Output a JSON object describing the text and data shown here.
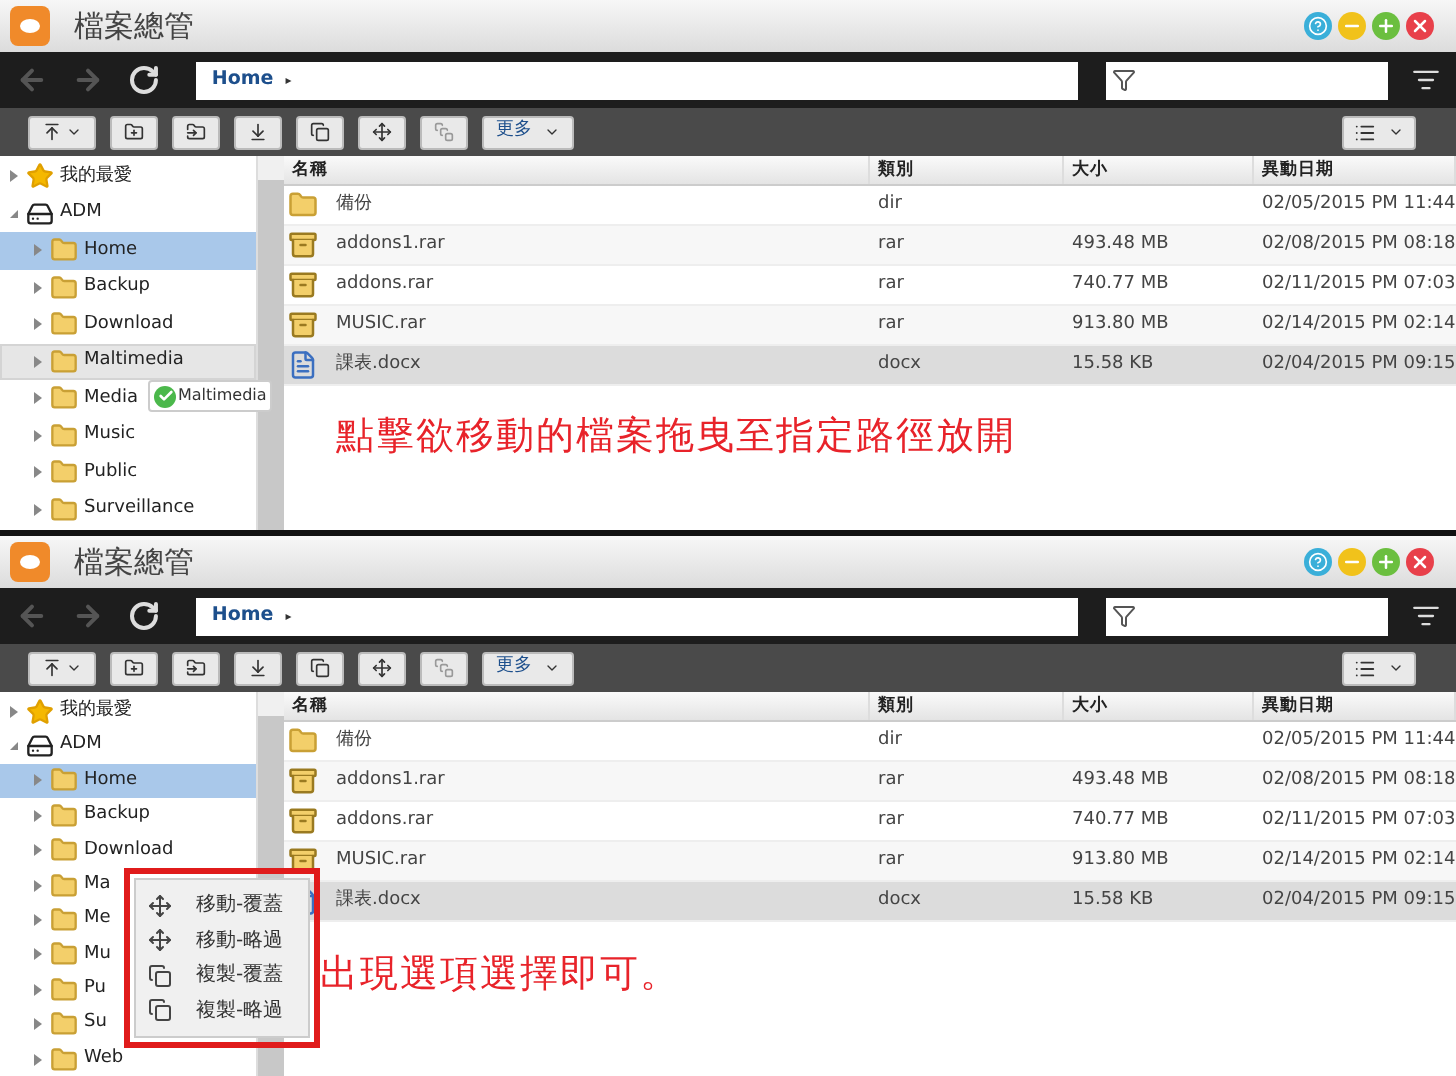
{
  "panels": [
    {
      "window": {
        "title": "檔案總管"
      },
      "path": {
        "segment": "Home",
        "separator": "▸"
      },
      "toolbar": {
        "more_button": "更多"
      },
      "sidebar": {
        "items": [
          {
            "label": "我的最愛",
            "kind": "favorites",
            "expanded": false,
            "selected": false,
            "hovered": false
          },
          {
            "label": "ADM",
            "kind": "device",
            "expanded": true,
            "selected": false,
            "hovered": false,
            "children": [
              {
                "label": "Home",
                "kind": "share",
                "expanded": false,
                "selected": true,
                "hovered": false
              },
              {
                "label": "Backup",
                "kind": "share",
                "expanded": false,
                "selected": false,
                "hovered": false
              },
              {
                "label": "Download",
                "kind": "share",
                "expanded": false,
                "selected": false,
                "hovered": false
              },
              {
                "label": "Maltimedia",
                "kind": "share",
                "expanded": false,
                "selected": false,
                "hovered": true
              },
              {
                "label": "Media",
                "kind": "share",
                "expanded": false,
                "selected": false,
                "hovered": false
              },
              {
                "label": "Music",
                "kind": "share",
                "expanded": false,
                "selected": false,
                "hovered": false
              },
              {
                "label": "Public",
                "kind": "share",
                "expanded": false,
                "selected": false,
                "hovered": false
              },
              {
                "label": "Surveillance",
                "kind": "share",
                "expanded": false,
                "selected": false,
                "hovered": false
              }
            ]
          }
        ]
      },
      "table": {
        "columns": [
          "名稱",
          "類別",
          "大小",
          "異動日期"
        ],
        "rows": [
          {
            "name": "備份",
            "type": "dir",
            "modified": "02/05/2015 PM 11:44",
            "kind": "folder",
            "selected": false
          },
          {
            "name": "addons1.rar",
            "type": "rar",
            "size": "493.48 MB",
            "modified": "02/08/2015 PM 08:18",
            "kind": "archive",
            "selected": false
          },
          {
            "name": "addons.rar",
            "type": "rar",
            "size": "740.77 MB",
            "modified": "02/11/2015 PM 07:03",
            "kind": "archive",
            "selected": false
          },
          {
            "name": "MUSIC.rar",
            "type": "rar",
            "size": "913.80 MB",
            "modified": "02/14/2015 PM 02:14",
            "kind": "archive",
            "selected": false
          },
          {
            "name": "課表.docx",
            "type": "docx",
            "size": "15.58 KB",
            "modified": "02/04/2015 PM 09:15",
            "kind": "document",
            "selected": true
          }
        ]
      },
      "drag_tooltip": {
        "label": "Maltimedia"
      },
      "annotation": {
        "text": "點擊欲移動的檔案拖曳至指定路徑放開"
      }
    },
    {
      "window": {
        "title": "檔案總管"
      },
      "path": {
        "segment": "Home",
        "separator": "▸"
      },
      "toolbar": {
        "more_button": "更多"
      },
      "sidebar": {
        "items": [
          {
            "label": "我的最愛",
            "kind": "favorites",
            "expanded": false,
            "selected": false,
            "hovered": false
          },
          {
            "label": "ADM",
            "kind": "device",
            "expanded": true,
            "selected": false,
            "hovered": false,
            "children": [
              {
                "label": "Home",
                "kind": "share",
                "expanded": false,
                "selected": true,
                "hovered": false
              },
              {
                "label": "Backup",
                "kind": "share",
                "expanded": false,
                "selected": false,
                "hovered": false
              },
              {
                "label": "Download",
                "kind": "share",
                "expanded": false,
                "selected": false,
                "hovered": false
              },
              {
                "label": "Ma",
                "kind": "share",
                "expanded": false,
                "selected": false,
                "hovered": false
              },
              {
                "label": "Me",
                "kind": "share",
                "expanded": false,
                "selected": false,
                "hovered": false
              },
              {
                "label": "Mu",
                "kind": "share",
                "expanded": false,
                "selected": false,
                "hovered": false
              },
              {
                "label": "Pu",
                "kind": "share",
                "expanded": false,
                "selected": false,
                "hovered": false
              },
              {
                "label": "Su",
                "kind": "share",
                "expanded": false,
                "selected": false,
                "hovered": false
              },
              {
                "label": "Web",
                "kind": "share",
                "expanded": false,
                "selected": false,
                "hovered": false
              }
            ]
          }
        ]
      },
      "table": {
        "columns": [
          "名稱",
          "類別",
          "大小",
          "異動日期"
        ],
        "rows": [
          {
            "name": "備份",
            "type": "dir",
            "modified": "02/05/2015 PM 11:44",
            "kind": "folder",
            "selected": false
          },
          {
            "name": "addons1.rar",
            "type": "rar",
            "size": "493.48 MB",
            "modified": "02/08/2015 PM 08:18",
            "kind": "archive",
            "selected": false
          },
          {
            "name": "addons.rar",
            "type": "rar",
            "size": "740.77 MB",
            "modified": "02/11/2015 PM 07:03",
            "kind": "archive",
            "selected": false
          },
          {
            "name": "MUSIC.rar",
            "type": "rar",
            "size": "913.80 MB",
            "modified": "02/14/2015 PM 02:14",
            "kind": "archive",
            "selected": false
          },
          {
            "name": "課表.docx",
            "type": "docx",
            "size": "15.58 KB",
            "modified": "02/04/2015 PM 09:15",
            "kind": "document",
            "selected": true
          }
        ]
      },
      "context_menu": {
        "highlighted": true,
        "items": [
          {
            "label": "移動-覆蓋",
            "kind": "move"
          },
          {
            "label": "移動-略過",
            "kind": "move"
          },
          {
            "label": "複製-覆蓋",
            "kind": "copy"
          },
          {
            "label": "複製-略過",
            "kind": "copy"
          }
        ]
      },
      "annotation": {
        "text": "出現選項選擇即可。"
      }
    }
  ]
}
